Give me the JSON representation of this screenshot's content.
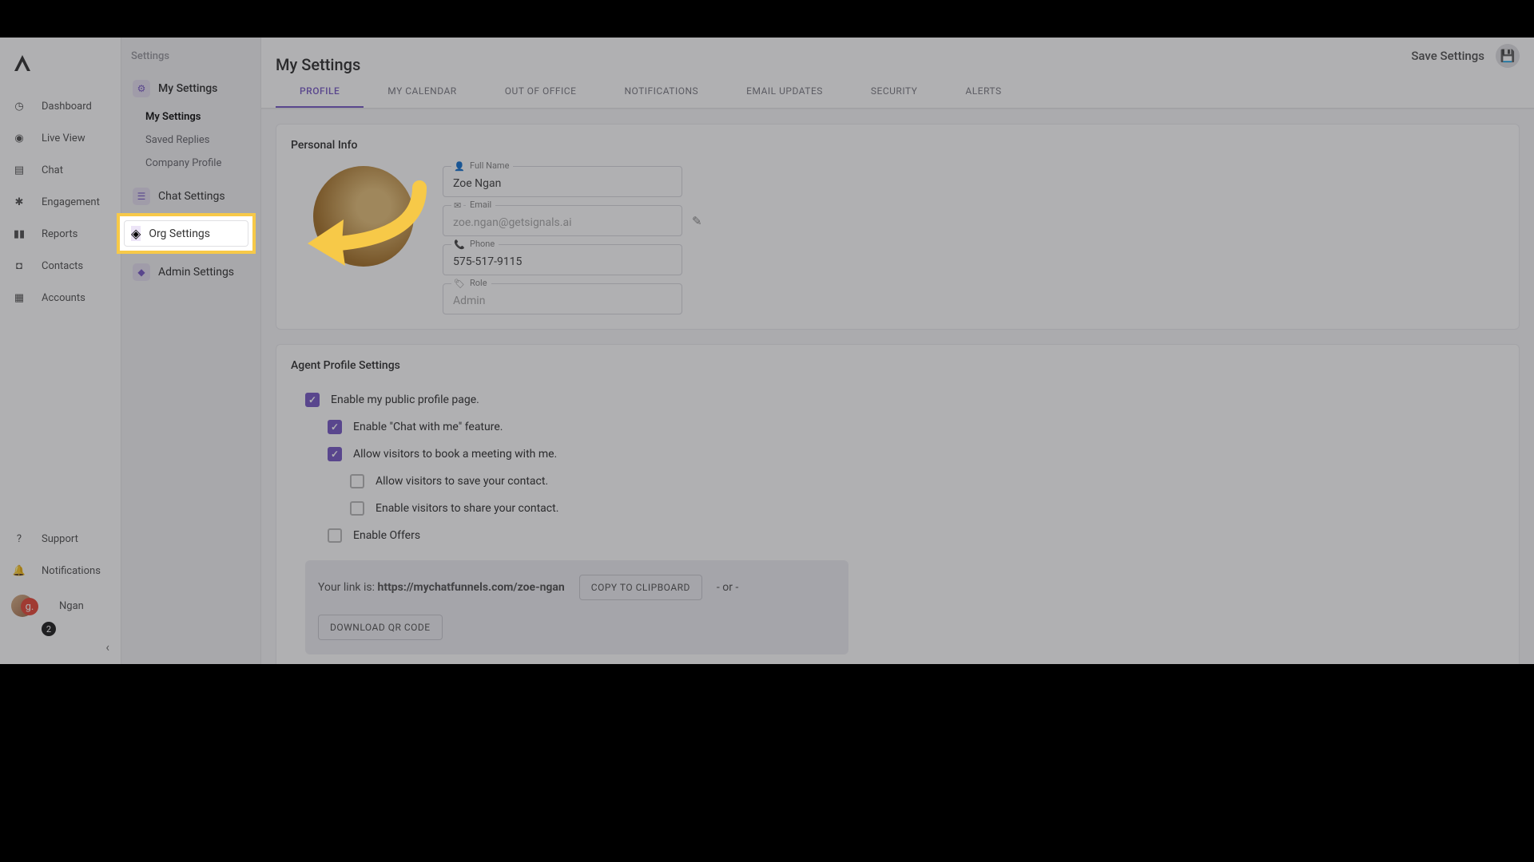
{
  "nav": {
    "items": [
      {
        "label": "Dashboard",
        "icon": "dashboard"
      },
      {
        "label": "Live View",
        "icon": "live"
      },
      {
        "label": "Chat",
        "icon": "chat"
      },
      {
        "label": "Engagement",
        "icon": "engagement"
      },
      {
        "label": "Reports",
        "icon": "reports"
      },
      {
        "label": "Contacts",
        "icon": "contacts"
      },
      {
        "label": "Accounts",
        "icon": "accounts"
      }
    ],
    "support": "Support",
    "notifications": "Notifications",
    "user_name": "Ngan",
    "badge": "2"
  },
  "settings": {
    "header": "Settings",
    "my_settings": "My Settings",
    "subs": [
      "My Settings",
      "Saved Replies",
      "Company Profile"
    ],
    "chat_settings": "Chat Settings",
    "org_settings": "Org Settings",
    "admin_settings": "Admin Settings"
  },
  "main": {
    "title": "My Settings",
    "save": "Save Settings",
    "tabs": [
      "PROFILE",
      "MY CALENDAR",
      "OUT OF OFFICE",
      "NOTIFICATIONS",
      "EMAIL UPDATES",
      "SECURITY",
      "ALERTS"
    ]
  },
  "personal": {
    "header": "Personal Info",
    "full_name_label": "Full Name",
    "full_name": "Zoe Ngan",
    "email_label": "Email",
    "email": "zoe.ngan@getsignals.ai",
    "phone_label": "Phone",
    "phone": "575-517-9115",
    "role_label": "Role",
    "role": "Admin"
  },
  "agent": {
    "header": "Agent Profile Settings",
    "items": [
      {
        "label": "Enable my public profile page.",
        "checked": true,
        "indent": 0
      },
      {
        "label": "Enable \"Chat with me\" feature.",
        "checked": true,
        "indent": 1
      },
      {
        "label": "Allow visitors to book a meeting with me.",
        "checked": true,
        "indent": 1
      },
      {
        "label": "Allow visitors to save your contact.",
        "checked": false,
        "indent": 2
      },
      {
        "label": "Enable visitors to share your contact.",
        "checked": false,
        "indent": 2
      },
      {
        "label": "Enable Offers",
        "checked": false,
        "indent": 1
      }
    ],
    "link_prefix": "Your link is: ",
    "link": "https://mychatfunnels.com/zoe-ngan",
    "copy": "COPY TO CLIPBOARD",
    "or": "- or -",
    "download": "DOWNLOAD QR CODE"
  }
}
